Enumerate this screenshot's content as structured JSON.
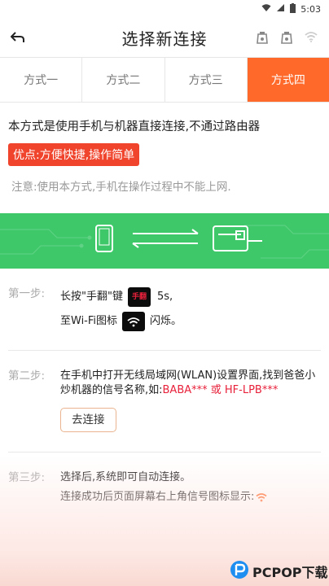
{
  "status_bar": {
    "time": "5:03"
  },
  "app_bar": {
    "title": "选择新连接",
    "back_icon": "back-arrow-icon"
  },
  "tabs": [
    {
      "label": "方式一",
      "active": false
    },
    {
      "label": "方式二",
      "active": false
    },
    {
      "label": "方式三",
      "active": false
    },
    {
      "label": "方式四",
      "active": true
    }
  ],
  "intro": {
    "description": "本方式是使用手机与机器直接连接,不通过路由器",
    "advantage": "优点:方便快捷,操作简单",
    "note": "注意:使用本方式,手机在操作过程中不能上网."
  },
  "steps": {
    "step1": {
      "label": "第一步:",
      "line1_prefix": "长按\"手翻\"键",
      "key_text": "手翻",
      "duration": "5s,",
      "line2_prefix": "至Wi-Fi图标",
      "line2_suffix": "闪烁。"
    },
    "step2": {
      "label": "第二步:",
      "text": "在手机中打开无线局域网(WLAN)设置界面,找到爸爸小炒机器的信号名称,如:",
      "highlight": "BABA*** 或 HF-LPB***",
      "button": "去连接"
    },
    "step3": {
      "label": "第三步:",
      "line1": "选择后,系统即可自动连接。",
      "line2": "连接成功后页面屏幕右上角信号图标显示:"
    }
  },
  "watermark": {
    "text": "PCPOP下载"
  },
  "colors": {
    "accent": "#ff6a2b",
    "badge": "#f0442c",
    "banner": "#3ec86a",
    "highlight": "#e8213b"
  }
}
